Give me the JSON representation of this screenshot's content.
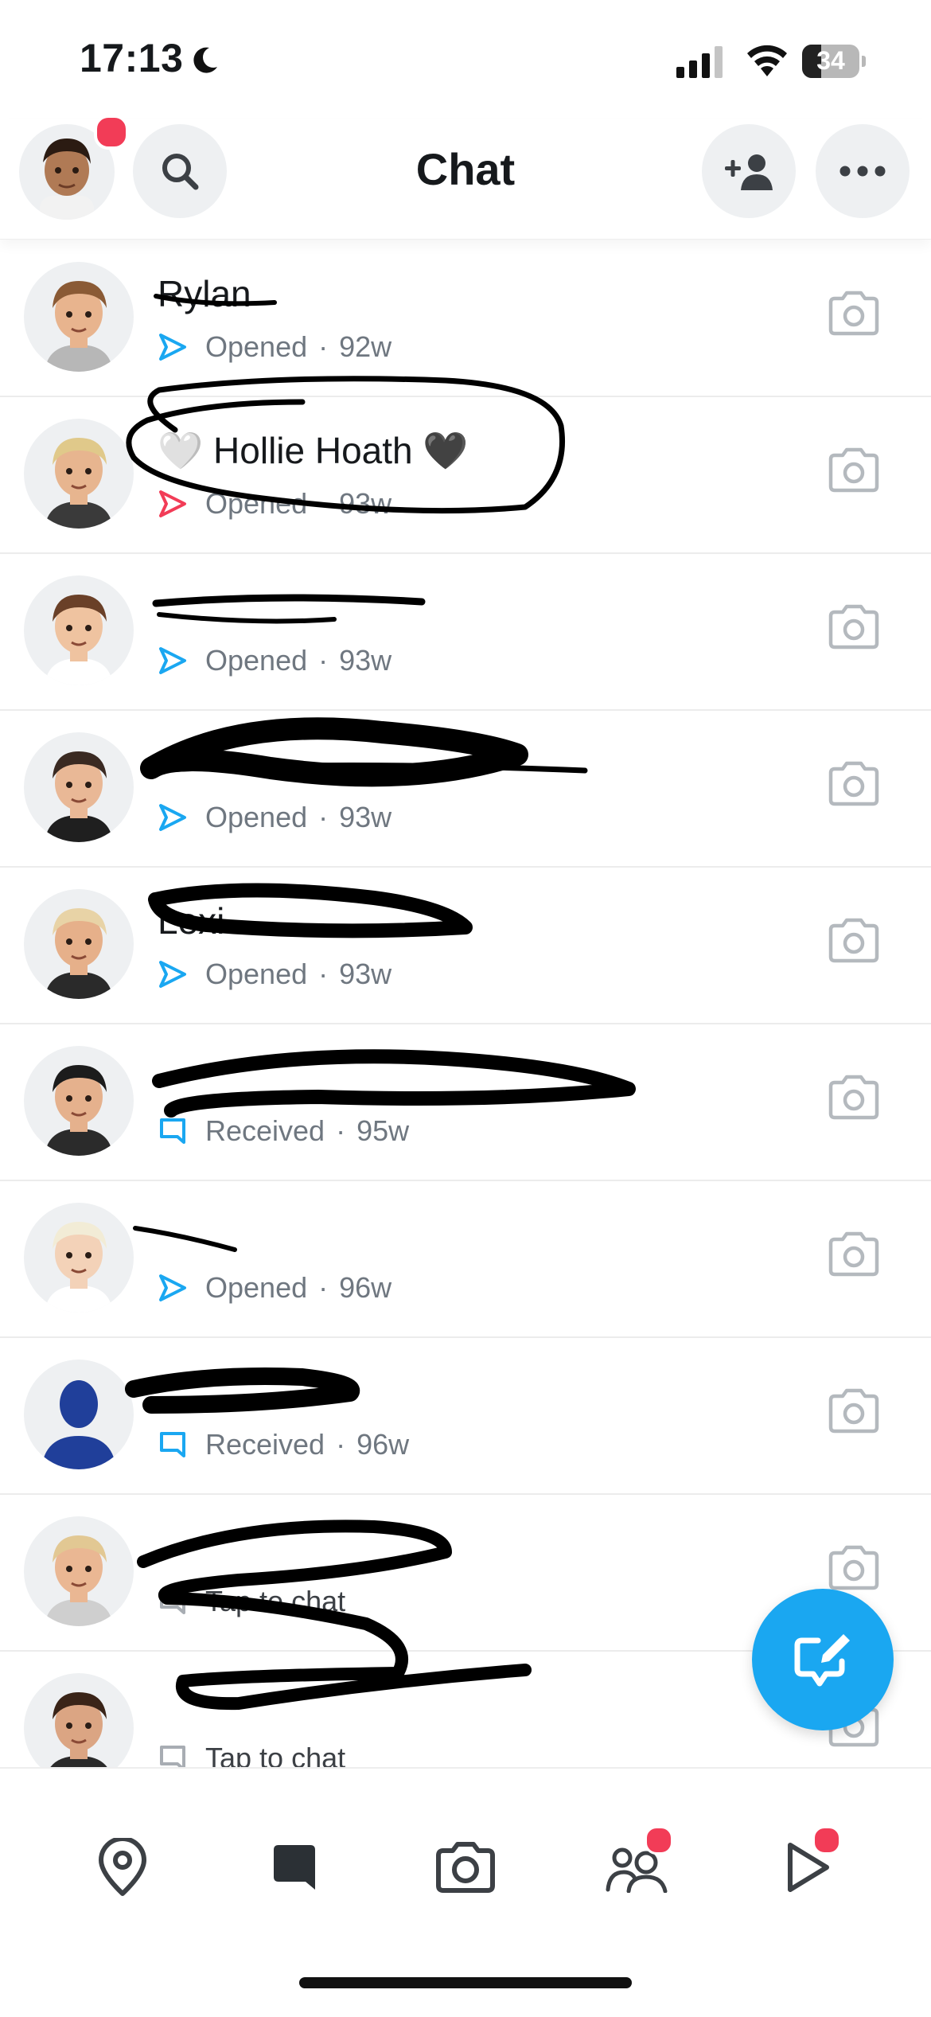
{
  "status_bar": {
    "time": "17:13",
    "battery_percent": "34",
    "battery_level": 0.34
  },
  "header": {
    "title": "Chat"
  },
  "chats": [
    {
      "name": "Rylan",
      "status": "Opened",
      "age": "92w",
      "kind": "opened"
    },
    {
      "name": "🤍 Hollie Hoath 🖤",
      "status": "Opened",
      "age": "93w",
      "kind": "opened-red"
    },
    {
      "name": "",
      "status": "Opened",
      "age": "93w",
      "kind": "opened"
    },
    {
      "name": "",
      "status": "Opened",
      "age": "93w",
      "kind": "opened"
    },
    {
      "name": "Lexi",
      "status": "Opened",
      "age": "93w",
      "kind": "opened"
    },
    {
      "name": "",
      "status": "Received",
      "age": "95w",
      "kind": "received"
    },
    {
      "name": "",
      "status": "Opened",
      "age": "96w",
      "kind": "opened"
    },
    {
      "name": "",
      "status": "Received",
      "age": "96w",
      "kind": "received"
    },
    {
      "name": "",
      "status": "Tap to chat",
      "age": "",
      "kind": "tap"
    },
    {
      "name": "",
      "status": "Tap to chat",
      "age": "",
      "kind": "tap"
    }
  ],
  "colors": {
    "accent": "#1aa7f1",
    "notification": "#f23c57",
    "opened": "#1aa7f1",
    "opened_red": "#f23c57",
    "meta_text": "#6f7780"
  },
  "icons": [
    "search-icon",
    "add-friend-icon",
    "more-icon",
    "camera-icon",
    "new-chat-icon",
    "map-icon",
    "chat-icon",
    "camera-tab-icon",
    "friends-icon",
    "stories-icon"
  ]
}
